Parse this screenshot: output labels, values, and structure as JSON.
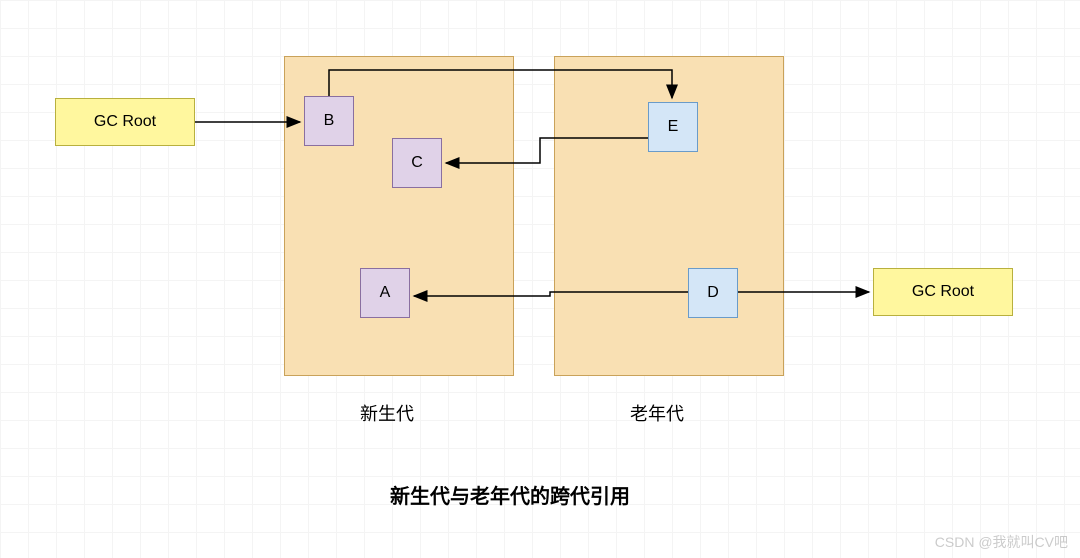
{
  "gcRootLeft": {
    "label": "GC Root"
  },
  "gcRootRight": {
    "label": "GC Root"
  },
  "youngGen": {
    "label": "新生代",
    "nodes": {
      "A": "A",
      "B": "B",
      "C": "C"
    }
  },
  "oldGen": {
    "label": "老年代",
    "nodes": {
      "D": "D",
      "E": "E"
    }
  },
  "caption": "新生代与老年代的跨代引用",
  "watermark": "CSDN @我就叫CV吧",
  "colors": {
    "yellow": "#fff79e",
    "orange": "#f9e0b3",
    "purple": "#e0d2e8",
    "blue": "#d4e6f7"
  },
  "edges": [
    {
      "from": "gcRootLeft",
      "to": "B"
    },
    {
      "from": "B",
      "to": "E"
    },
    {
      "from": "E",
      "to": "C"
    },
    {
      "from": "D",
      "to": "A"
    },
    {
      "from": "D",
      "to": "gcRootRight"
    }
  ]
}
